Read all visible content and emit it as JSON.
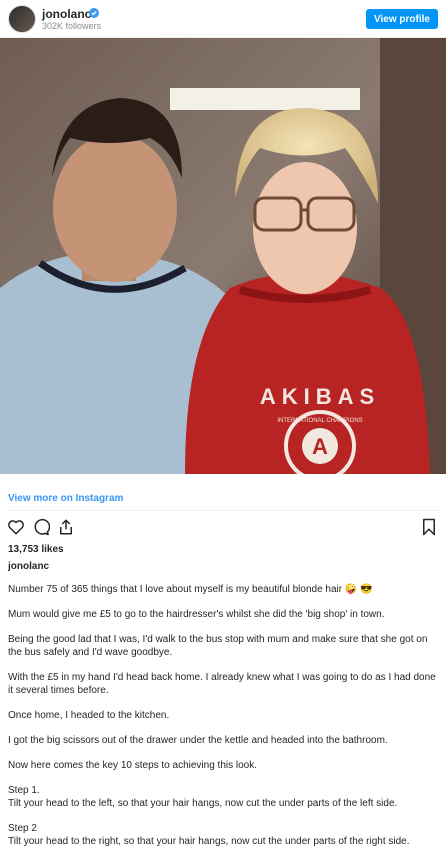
{
  "header": {
    "username": "jonolanc",
    "followers": "302K followers",
    "view_profile_label": "View profile"
  },
  "post": {
    "view_more_label": "View more on Instagram",
    "likes": "13,753 likes",
    "owner": "jonolanc",
    "caption": [
      "Number 75 of 365 things that I love about myself is my beautiful blonde hair 🤪 😎",
      "Mum would give me £5 to go to the hairdresser's whilst she did the 'big shop' in town.",
      "Being the good lad that I was, I'd walk to the bus stop with mum and make sure that she got on the bus safely and I'd wave goodbye.",
      "With the £5 in my hand I'd head back home. I already knew what I was going to do as I had done it several times before.",
      "Once home, I headed to the kitchen.",
      "I got the big scissors out of the drawer under the kettle and headed into the bathroom.",
      "Now here comes the key 10 steps to achieving this look.",
      "Step 1.",
      "Tilt your head to the left, so that your hair hangs, now cut the under parts of the left side.",
      "Step 2",
      "Tilt your head to the right, so that your hair hangs, now cut the under parts of the right side."
    ],
    "shirt_text": "AKIBAS",
    "badge_text": "INTERNATIONAL CHAMPIONS",
    "badge_letter": "A"
  },
  "colors": {
    "accent": "#0095f6",
    "link": "#3897f0",
    "text": "#262626",
    "muted": "#8e8e8e"
  },
  "icons": [
    "verified-badge-icon",
    "heart-icon",
    "comment-icon",
    "share-icon",
    "bookmark-icon"
  ]
}
